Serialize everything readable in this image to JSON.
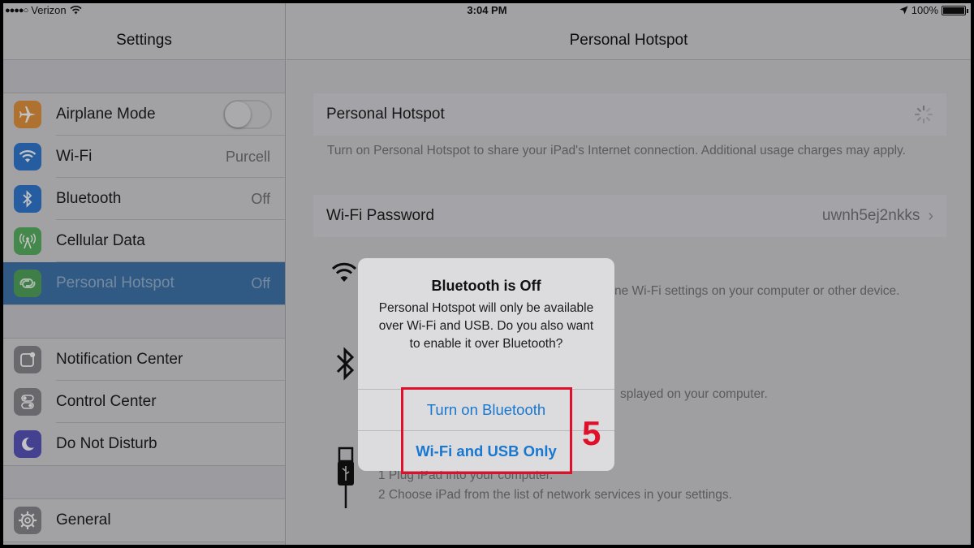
{
  "status_bar": {
    "carrier": "Verizon",
    "time": "3:04 PM",
    "battery": "100%"
  },
  "sidebar": {
    "title": "Settings",
    "groups": [
      [
        {
          "label": "Airplane Mode",
          "value": "",
          "icon": "airplane-icon",
          "color": "#f0973a",
          "toggle": false
        },
        {
          "label": "Wi-Fi",
          "value": "Purcell",
          "icon": "wifi-icon",
          "color": "#2f7fe0"
        },
        {
          "label": "Bluetooth",
          "value": "Off",
          "icon": "bluetooth-icon",
          "color": "#2f7fe0"
        },
        {
          "label": "Cellular Data",
          "value": "",
          "icon": "cellular-icon",
          "color": "#5cc464"
        },
        {
          "label": "Personal Hotspot",
          "value": "Off",
          "icon": "hotspot-icon",
          "color": "#5cc464",
          "selected": true
        }
      ],
      [
        {
          "label": "Notification Center",
          "value": "",
          "icon": "notification-icon",
          "color": "#8e8e93"
        },
        {
          "label": "Control Center",
          "value": "",
          "icon": "control-center-icon",
          "color": "#8e8e93"
        },
        {
          "label": "Do Not Disturb",
          "value": "",
          "icon": "moon-icon",
          "color": "#5e5ce6"
        }
      ],
      [
        {
          "label": "General",
          "value": "",
          "icon": "gear-icon",
          "color": "#8e8e93"
        }
      ]
    ]
  },
  "main": {
    "title": "Personal Hotspot",
    "hotspot_label": "Personal Hotspot",
    "hotspot_note": "Turn on Personal Hotspot to share your iPad's Internet connection. Additional usage charges may apply.",
    "wifi_password_label": "Wi-Fi Password",
    "wifi_password_value": "uwnh5ej2nkks",
    "wifi_instruction": "ne Wi-Fi settings on your computer or other device.",
    "bluetooth_instruction": "splayed on your computer.",
    "usb_step1": "1 Plug iPad into your computer.",
    "usb_step2": "2 Choose iPad from the list of network services in your settings."
  },
  "alert": {
    "title": "Bluetooth is Off",
    "message": "Personal Hotspot will only be available over Wi-Fi and USB. Do you also want to enable it over Bluetooth?",
    "button_bluetooth": "Turn on Bluetooth",
    "button_wifi_usb": "Wi-Fi and USB Only"
  },
  "annotation": {
    "step": "5",
    "color": "#e0102a"
  }
}
